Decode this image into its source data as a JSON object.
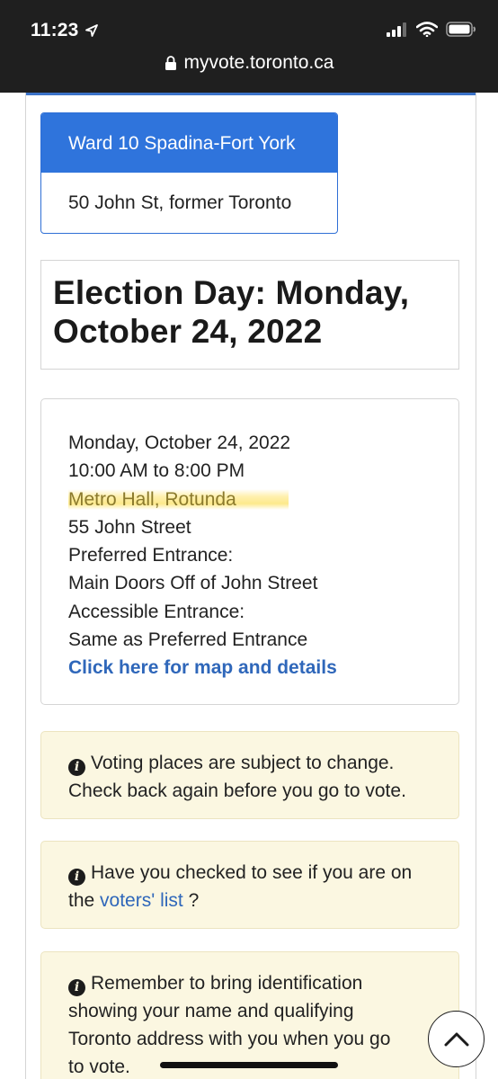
{
  "status_bar": {
    "time": "11:23"
  },
  "browser": {
    "url": "myvote.toronto.ca"
  },
  "ward": {
    "name": "Ward 10 Spadina-Fort York",
    "address": "50 John St, former Toronto"
  },
  "election_day": {
    "title": "Election Day: Monday, October 24, 2022"
  },
  "voting_place": {
    "date": "Monday, October 24, 2022",
    "hours": "10:00 AM to 8:00 PM",
    "location": "Metro Hall, Rotunda",
    "street": "55 John Street",
    "preferred_label": "Preferred Entrance:",
    "preferred_value": "Main Doors Off of John Street",
    "accessible_label": "Accessible Entrance:",
    "accessible_value": "Same as Preferred Entrance",
    "map_link": "Click here for map and details"
  },
  "notices": {
    "change_line1": "Voting places are subject to change.",
    "change_line2": "Check back again before you go to vote.",
    "voters_line1": "Have you checked to see if you are on",
    "voters_pre": "the",
    "voters_link": "voters' list",
    "voters_post": "?",
    "id_line1": "Remember to bring identification",
    "id_line2": "showing your name and qualifying",
    "id_line3": "Toronto address with you when you go",
    "id_line4": "to vote."
  },
  "colors": {
    "ward_header": "#2f74dc",
    "link": "#2f67ba",
    "notice_bg": "#fbf7e1",
    "highlight": "#fce05a"
  },
  "icons": {
    "location": "location-arrow-icon",
    "lock": "lock-icon",
    "info": "info-icon",
    "scroll_top": "chevron-up-icon"
  }
}
